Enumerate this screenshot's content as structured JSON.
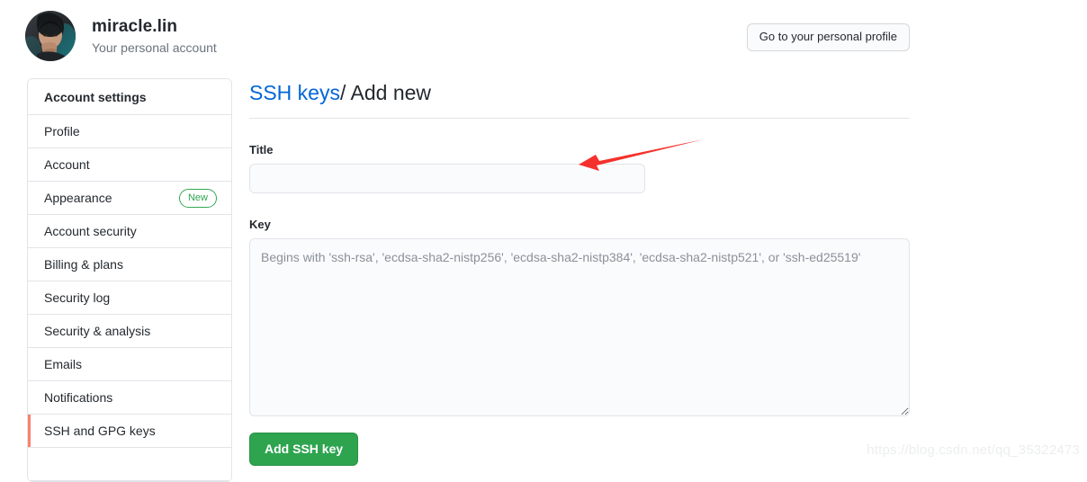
{
  "header": {
    "account_name": "miracle.lin",
    "account_subtitle": "Your personal account",
    "profile_button": "Go to your personal profile"
  },
  "sidebar": {
    "heading": "Account settings",
    "items": [
      {
        "label": "Profile",
        "badge": ""
      },
      {
        "label": "Account",
        "badge": ""
      },
      {
        "label": "Appearance",
        "badge": "New"
      },
      {
        "label": "Account security",
        "badge": ""
      },
      {
        "label": "Billing & plans",
        "badge": ""
      },
      {
        "label": "Security log",
        "badge": ""
      },
      {
        "label": "Security & analysis",
        "badge": ""
      },
      {
        "label": "Emails",
        "badge": ""
      },
      {
        "label": "Notifications",
        "badge": ""
      },
      {
        "label": "SSH and GPG keys",
        "badge": ""
      }
    ],
    "selected": "SSH and GPG keys",
    "accent_color": "#f9826c"
  },
  "main": {
    "breadcrumb_link": "SSH keys",
    "breadcrumb_separator": "/",
    "breadcrumb_current": "Add new",
    "title_label": "Title",
    "title_value": "",
    "title_placeholder": "",
    "key_label": "Key",
    "key_value": "",
    "key_placeholder": "Begins with 'ssh-rsa', 'ecdsa-sha2-nistp256', 'ecdsa-sha2-nistp384', 'ecdsa-sha2-nistp521', or 'ssh-ed25519'",
    "submit_label": "Add SSH key",
    "link_color": "#0366d6",
    "submit_color": "#2ea44f"
  },
  "annotation": {
    "arrow_color": "#f5312d"
  },
  "watermark": {
    "text": "https://blog.csdn.net/qq_35322473"
  }
}
